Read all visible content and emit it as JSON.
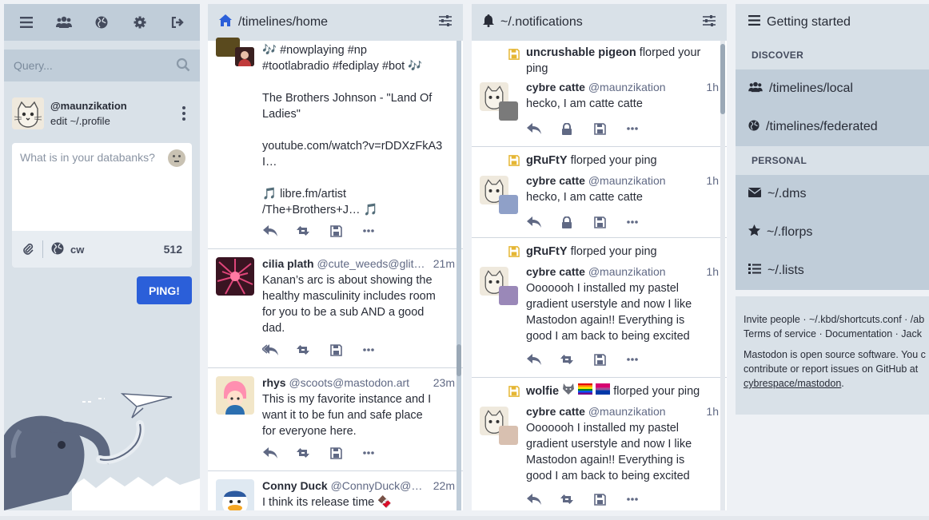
{
  "compose": {
    "search_placeholder": "Query...",
    "account_handle": "@maunzikation",
    "edit_profile": "edit ~/.profile",
    "textarea_placeholder": "What is in your databanks?",
    "cw_label": "cw",
    "char_count": "512",
    "publish_label": "PING!"
  },
  "home": {
    "title": "/timelines/home",
    "statuses": [
      {
        "content_lines": [
          "🎶 #nowplaying #np",
          "#tootlabradio #fediplay #bot 🎶",
          "",
          "The Brothers Johnson - \"Land Of",
          "Ladies\"",
          "",
          "youtube.com/watch?v=rDDXzFkA3",
          "I…",
          "",
          "🎵 libre.fm/artist",
          "/The+Brothers+J… 🎵"
        ]
      },
      {
        "name": "cilia plath",
        "handle": "@cute_weeds@glit…",
        "time": "21m",
        "content_lines": [
          "Kanan’s arc is about showing the",
          "healthy masculinity includes room",
          "for you to be a sub AND a good",
          "dad."
        ]
      },
      {
        "name": "rhys",
        "handle": "@scoots@mastodon.art",
        "time": "23m",
        "content_lines": [
          "This is my favorite instance and I",
          "want it to be fun and safe place",
          "for everyone here."
        ]
      },
      {
        "name": "Conny Duck",
        "handle": "@ConnyDuck@…",
        "time": "22m",
        "content_lines": [
          "I think its release time 🍫"
        ]
      }
    ]
  },
  "notifications": {
    "title": "~/.notifications",
    "items": [
      {
        "actor": "uncrushable pigeon",
        "action": "florped your",
        "action2": "ping",
        "name": "cybre catte",
        "handle": "@maunzikation",
        "time": "1h",
        "content_lines": [
          "hecko, I am catte catte"
        ]
      },
      {
        "actor": "gRuFtY",
        "action": "florped your ping",
        "name": "cybre catte",
        "handle": "@maunzikation",
        "time": "1h",
        "content_lines": [
          "hecko, I am catte catte"
        ]
      },
      {
        "actor": "gRuFtY",
        "action": "florped your ping",
        "name": "cybre catte",
        "handle": "@maunzikation",
        "time": "1h",
        "content_lines": [
          "Ooooooh I installed my pastel",
          "gradient userstyle and now I like",
          "Mastodon again!! Everything is",
          "good I am back to being excited"
        ]
      },
      {
        "actor": "wolfie",
        "action": "florped your ping",
        "name": "cybre catte",
        "handle": "@maunzikation",
        "time": "1h",
        "content_lines": [
          "Ooooooh I installed my pastel",
          "gradient userstyle and now I like",
          "Mastodon again!! Everything is",
          "good I am back to being excited"
        ]
      }
    ]
  },
  "getting_started": {
    "title": "Getting started",
    "discover_label": "DISCOVER",
    "local": "/timelines/local",
    "federated": "/timelines/federated",
    "personal_label": "PERSONAL",
    "dms": "~/.dms",
    "florps": "~/.florps",
    "lists": "~/.lists",
    "footer_links1": "Invite people · ~/.kbd/shortcuts.conf · /ab",
    "footer_links2": "Terms of service · Documentation · Jack",
    "footer_text": "Mastodon is open source software. You c contribute or report issues on GitHub at",
    "footer_repo": "cybrespace/mastodon",
    "footer_period": "."
  },
  "colors": {
    "accent": "#2b5fd9",
    "boost_indicator": "#e5b634",
    "column_header": "#d9e1e8",
    "nav_item": "#c0cdd9"
  }
}
